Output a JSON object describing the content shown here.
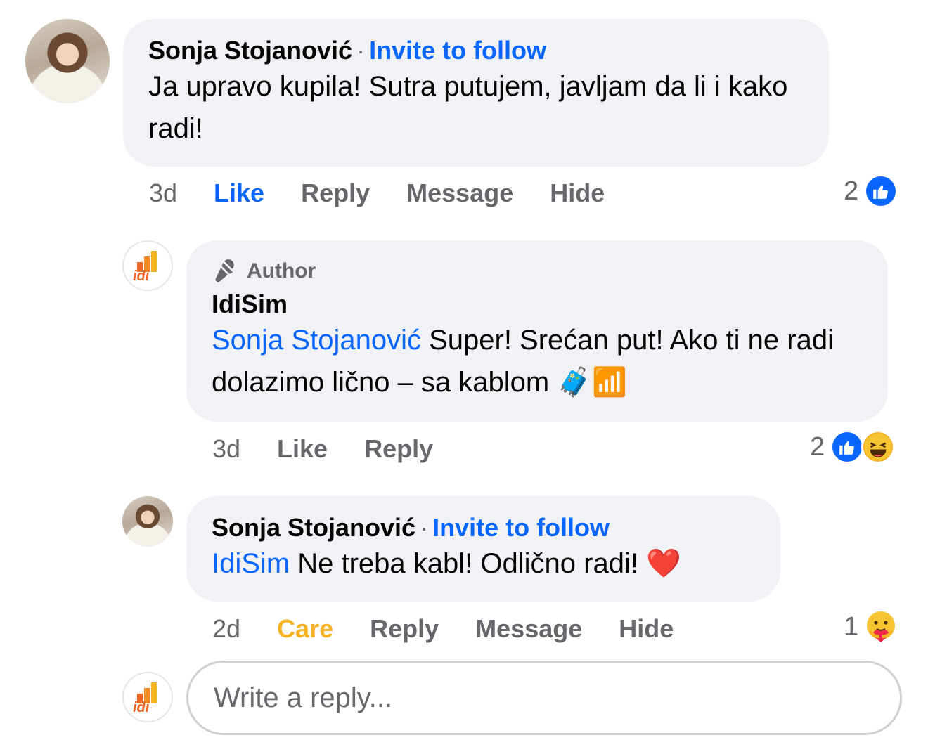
{
  "comment1": {
    "author": "Sonja Stojanović",
    "separator": "·",
    "follow": "Invite to follow",
    "text": "Ja upravo kupila! Sutra putujem, javljam da li i kako radi!",
    "time": "3d",
    "actions": [
      "Like",
      "Reply",
      "Message",
      "Hide"
    ],
    "reaction_count": "2"
  },
  "reply1": {
    "badge": "Author",
    "author": "IdiSim",
    "mention": "Sonja Stojanović",
    "text": " Super! Srećan put! Ako ti ne radi dolazimo lično – sa kablom 🧳📶",
    "time": "3d",
    "actions": [
      "Like",
      "Reply"
    ],
    "reaction_count": "2"
  },
  "reply2": {
    "author": "Sonja Stojanović",
    "separator": "·",
    "follow": "Invite to follow",
    "mention": "IdiSim",
    "text": " Ne treba kabl! Odlično radi! ❤️",
    "time": "2d",
    "actions": [
      "Care",
      "Reply",
      "Message",
      "Hide"
    ],
    "reaction_count": "1"
  },
  "composer": {
    "placeholder": "Write a reply..."
  },
  "logo_text": "idi",
  "colors": {
    "link_blue": "#0866ff",
    "care_yellow": "#f7b125",
    "bubble_gray": "#f0f2f5",
    "meta_gray": "#65676b",
    "logo_orange": "#f26522"
  }
}
